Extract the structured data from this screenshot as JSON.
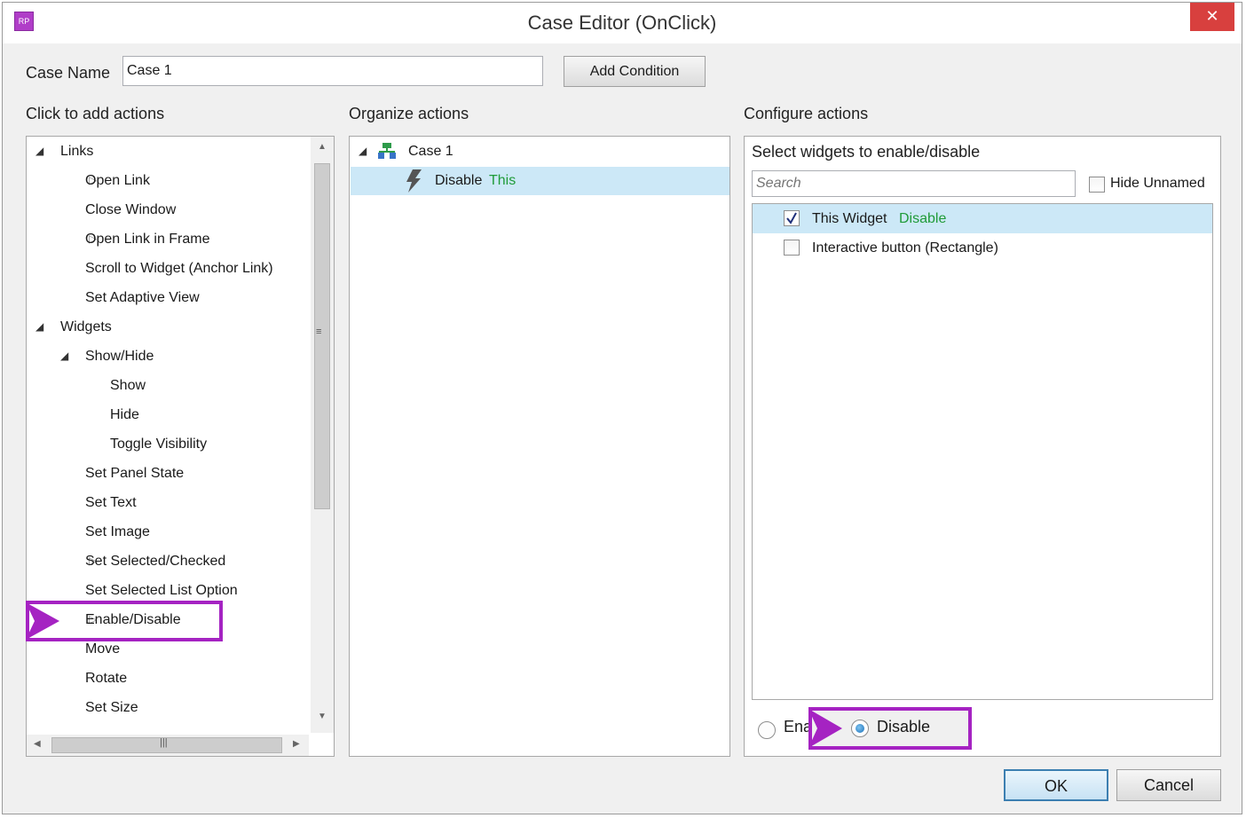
{
  "window": {
    "title": "Case Editor (OnClick)",
    "app_icon_text": "RP",
    "close_glyph": "✕",
    "accent_color": "#a523c2"
  },
  "case_name": {
    "label": "Case Name",
    "value": "Case 1",
    "add_condition_label": "Add Condition"
  },
  "add_actions": {
    "heading": "Click to add actions",
    "items": [
      {
        "label": "Links",
        "expander": "expanded"
      },
      {
        "label": "Open Link",
        "expander": "collapsed"
      },
      {
        "label": "Close Window",
        "expander": "none"
      },
      {
        "label": "Open Link in Frame",
        "expander": "collapsed"
      },
      {
        "label": "Scroll to Widget (Anchor Link)",
        "expander": "none"
      },
      {
        "label": "Set Adaptive View",
        "expander": "none"
      },
      {
        "label": "Widgets",
        "expander": "expanded"
      },
      {
        "label": "Show/Hide",
        "expander": "expanded"
      },
      {
        "label": "Show",
        "expander": "none"
      },
      {
        "label": "Hide",
        "expander": "none"
      },
      {
        "label": "Toggle Visibility",
        "expander": "none"
      },
      {
        "label": "Set Panel State",
        "expander": "none"
      },
      {
        "label": "Set Text",
        "expander": "none"
      },
      {
        "label": "Set Image",
        "expander": "none"
      },
      {
        "label": "Set Selected/Checked",
        "expander": "collapsed"
      },
      {
        "label": "Set Selected List Option",
        "expander": "none"
      },
      {
        "label": "Enable/Disable",
        "expander": "collapsed"
      },
      {
        "label": "Move",
        "expander": "none"
      },
      {
        "label": "Rotate",
        "expander": "none"
      },
      {
        "label": "Set Size",
        "expander": "none"
      }
    ]
  },
  "organize": {
    "heading": "Organize actions",
    "case_label": "Case 1",
    "action_verb": "Disable",
    "action_target": "This"
  },
  "configure": {
    "heading": "Configure actions",
    "subheading": "Select widgets to enable/disable",
    "search_placeholder": "Search",
    "hide_unnamed_label": "Hide Unnamed",
    "widgets": [
      {
        "name": "This Widget",
        "state": "Disable",
        "checked": true
      },
      {
        "name": "Interactive button (Rectangle)",
        "state": "",
        "checked": false
      }
    ],
    "enable_label_visible": "Ena",
    "disable_label": "Disable"
  },
  "footer": {
    "ok_label": "OK",
    "cancel_label": "Cancel"
  }
}
